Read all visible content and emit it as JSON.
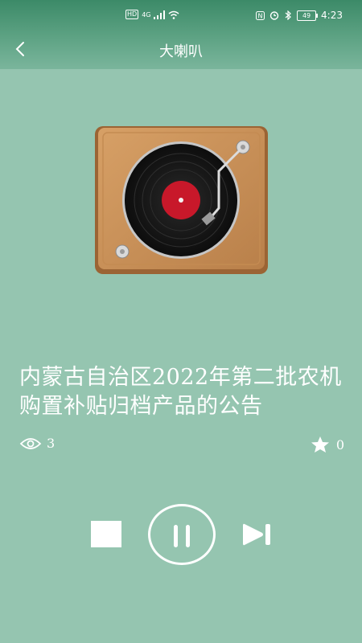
{
  "status_bar": {
    "left_badge": "HD",
    "network": "4G",
    "battery": "49",
    "time": "4:23"
  },
  "header": {
    "title": "大喇叭"
  },
  "article": {
    "title": "内蒙古自治区2022年第二批农机购置补贴归档产品的公告",
    "views": "3",
    "favorites": "0"
  },
  "icons": {
    "back": "chevron-left-icon",
    "views": "eye-icon",
    "favorites": "star-icon",
    "stop": "stop-icon",
    "pause": "pause-icon",
    "next": "skip-next-icon"
  },
  "colors": {
    "background": "#95c5b0",
    "header": "#5ea384",
    "foreground": "#ffffff"
  }
}
